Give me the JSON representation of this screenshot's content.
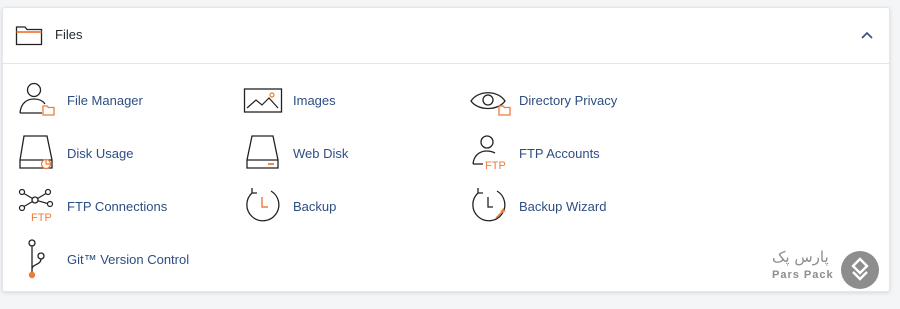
{
  "section": {
    "title": "Files",
    "title_icon": "folder-icon",
    "collapse_icon": "chevron-up-icon"
  },
  "items": [
    {
      "label": "File Manager",
      "icon": "file-manager-icon"
    },
    {
      "label": "Images",
      "icon": "images-icon"
    },
    {
      "label": "Directory Privacy",
      "icon": "directory-privacy-icon"
    },
    {
      "label": "Disk Usage",
      "icon": "disk-usage-icon"
    },
    {
      "label": "Web Disk",
      "icon": "web-disk-icon"
    },
    {
      "label": "FTP Accounts",
      "icon": "ftp-accounts-icon"
    },
    {
      "label": "FTP Connections",
      "icon": "ftp-connections-icon"
    },
    {
      "label": "Backup",
      "icon": "backup-icon"
    },
    {
      "label": "Backup Wizard",
      "icon": "backup-wizard-icon"
    },
    {
      "label": "Git™ Version Control",
      "icon": "git-version-control-icon"
    }
  ],
  "icon_text": {
    "ftp": "FTP"
  },
  "watermark": {
    "name_fa": "پارس پک",
    "name_en": "Pars Pack"
  },
  "colors": {
    "link": "#2d4e82",
    "icon_stroke": "#222222",
    "accent": "#ef7b3b",
    "watermark": "#8d8d8d"
  }
}
